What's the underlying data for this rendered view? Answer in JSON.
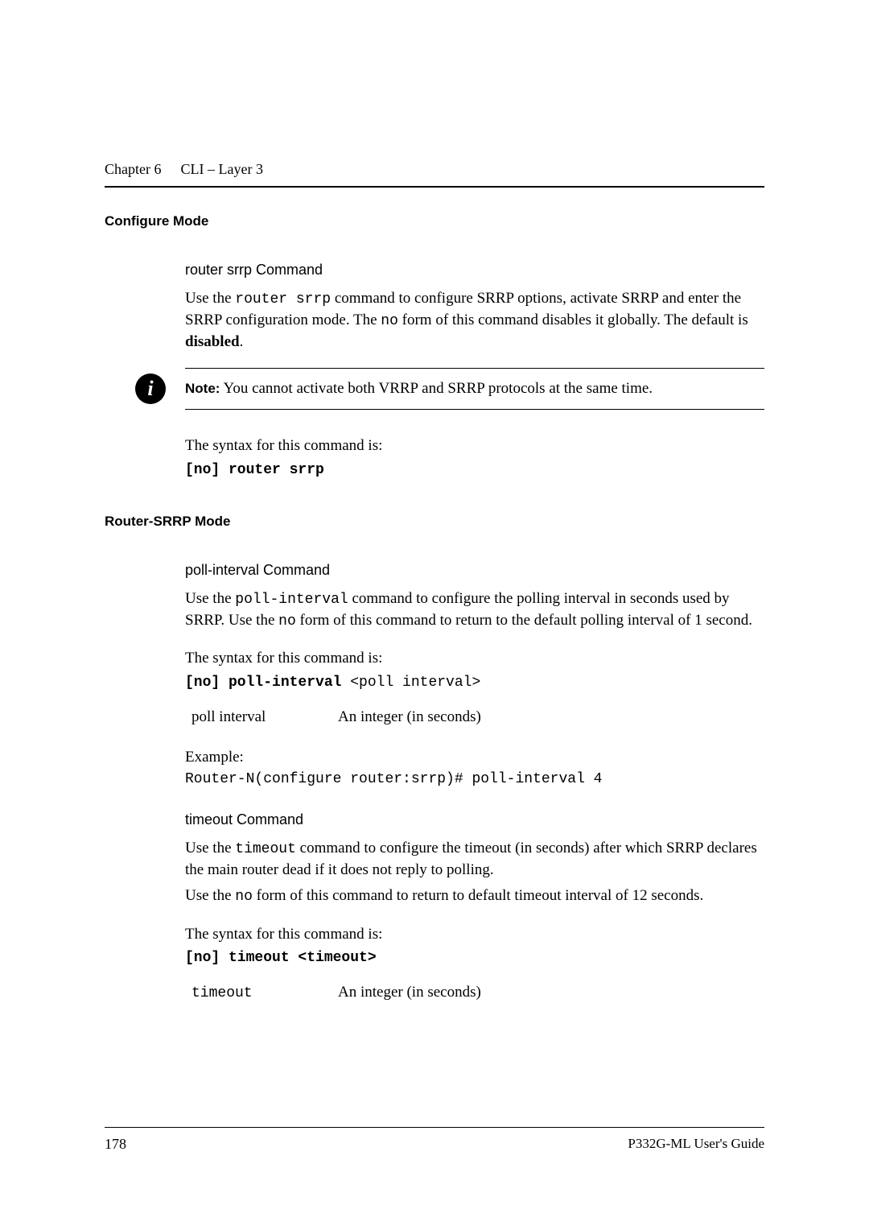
{
  "header": {
    "chapter": "Chapter 6",
    "title": "CLI – Layer 3"
  },
  "section1": {
    "mode": "Configure Mode",
    "title": "router srrp Command",
    "desc_pre": "Use the ",
    "desc_cmd": "router srrp",
    "desc_mid1": " command to configure SRRP options, activate SRRP and enter the SRRP configuration mode. The ",
    "desc_cmd2": "no",
    "desc_mid2": " form of this command disables it globally. The default is ",
    "desc_bold": "disabled",
    "desc_end": ".",
    "note_label": "Note:",
    "note_text": "  You cannot activate both VRRP and SRRP protocols at the same time.",
    "syntax_intro": "The syntax for this command is:",
    "syntax": "[no] router srrp"
  },
  "section2": {
    "mode": "Router-SRRP Mode",
    "sub1": {
      "title": "poll-interval Command",
      "desc_pre": "Use the ",
      "desc_cmd": "poll-interval",
      "desc_mid": " command to configure the polling interval in seconds used by SRRP. Use the ",
      "desc_cmd2": "no",
      "desc_end": " form of this command to return to the default polling interval of 1 second.",
      "syntax_intro": "The syntax for this command is:",
      "syntax_bold": "[no] poll-interval ",
      "syntax_param": "<poll interval>",
      "param_name": "poll interval",
      "param_desc": "An integer (in seconds)",
      "example_label": "Example:",
      "example_code": "Router-N(configure router:srrp)# poll-interval 4"
    },
    "sub2": {
      "title": "timeout Command",
      "desc_pre": "Use the ",
      "desc_cmd": "timeout",
      "desc_end": " command to configure the timeout (in seconds) after which SRRP declares the main router dead if it does not reply to polling.",
      "desc2_pre": "Use the ",
      "desc2_cmd": "no",
      "desc2_end": " form of this command to return to default timeout interval of 12 seconds.",
      "syntax_intro": "The syntax for this command is:",
      "syntax": "[no] timeout <timeout>",
      "param_name": "timeout",
      "param_desc": "An integer (in seconds)"
    }
  },
  "footer": {
    "page": "178",
    "guide": "P332G-ML User's Guide"
  }
}
